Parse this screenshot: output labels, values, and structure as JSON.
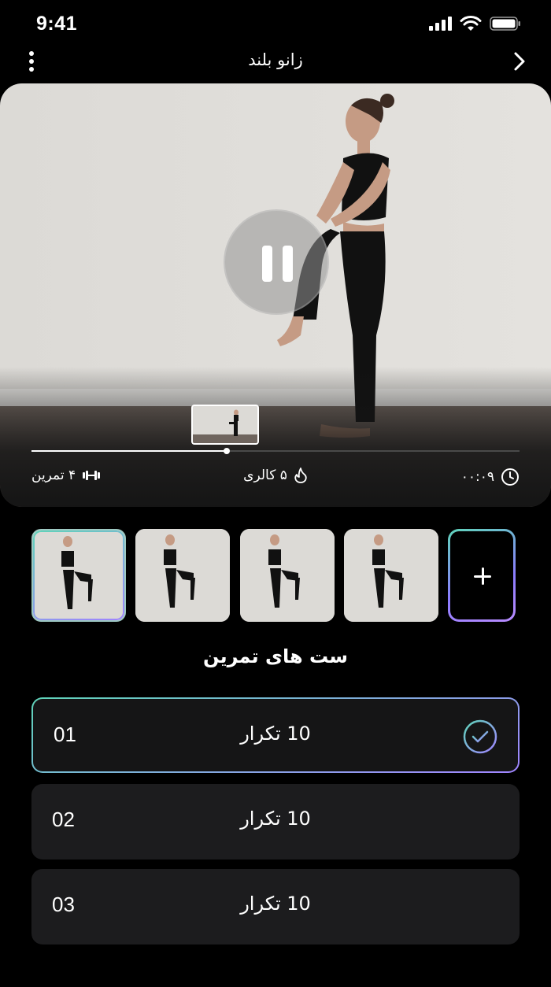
{
  "status_bar": {
    "time": "9:41",
    "icons": [
      "signal-icon",
      "wifi-icon",
      "battery-icon"
    ]
  },
  "nav": {
    "title": "زانو بلند",
    "menu_icon": "more-vertical-icon",
    "back_icon": "chevron-right-icon"
  },
  "player": {
    "state": "playing",
    "control_icon": "pause-icon",
    "progress": 0.4
  },
  "stats": {
    "exercises": "۴ تمرین",
    "exercises_icon": "dumbbell-icon",
    "calories": "۵ کالری",
    "calories_icon": "flame-icon",
    "duration": "۰۰:۰۹",
    "duration_icon": "clock-icon"
  },
  "thumbnails": {
    "count": 4,
    "selected_index": 0,
    "add_icon": "plus-icon"
  },
  "sets_section": {
    "title": "ست های تمرین",
    "sets": [
      {
        "number": "01",
        "reps": "10 تکرار",
        "done": true
      },
      {
        "number": "02",
        "reps": "10 تکرار",
        "done": false
      },
      {
        "number": "03",
        "reps": "10 تکرار",
        "done": false
      }
    ]
  },
  "colors": {
    "background": "#000000",
    "card": "#151515",
    "set_row": "#1c1c1e",
    "accent_start": "#5fd4b9",
    "accent_end": "#a084ff"
  }
}
